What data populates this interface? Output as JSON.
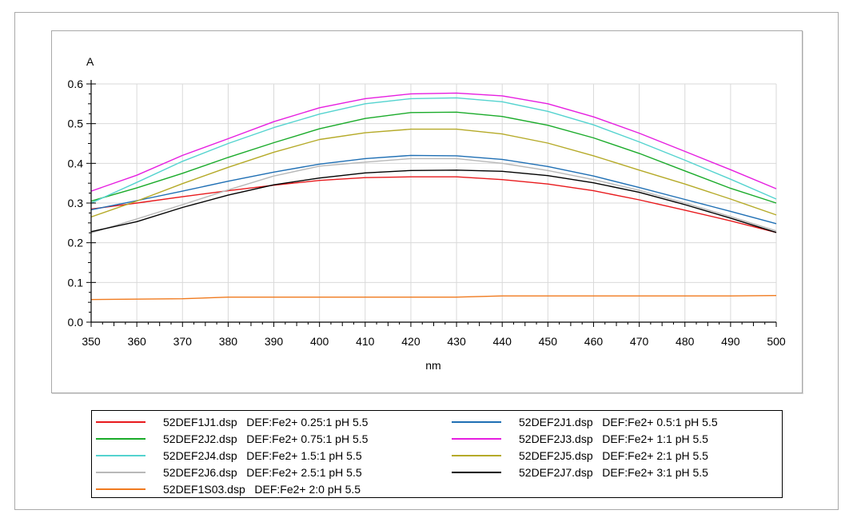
{
  "chart_data": {
    "type": "line",
    "ylabel": "A",
    "xlabel": "nm",
    "xlim": [
      350,
      500
    ],
    "ylim": [
      0,
      0.6
    ],
    "xticks": [
      "350",
      "360",
      "370",
      "380",
      "390",
      "400",
      "410",
      "420",
      "430",
      "440",
      "450",
      "460",
      "470",
      "480",
      "490",
      "500"
    ],
    "yticks": [
      "0.0",
      "0.1",
      "0.2",
      "0.3",
      "0.4",
      "0.5",
      "0.6"
    ],
    "grid": true,
    "legend_position": "bottom",
    "x": [
      350,
      360,
      370,
      380,
      390,
      400,
      410,
      420,
      430,
      440,
      450,
      460,
      470,
      480,
      490,
      500
    ],
    "series": [
      {
        "name": "52DEF1J1.dsp   DEF:Fe2+ 0.25:1 pH 5.5",
        "color": "#e8191c",
        "values": [
          0.285,
          0.3,
          0.316,
          0.331,
          0.345,
          0.357,
          0.364,
          0.366,
          0.366,
          0.359,
          0.348,
          0.331,
          0.308,
          0.282,
          0.255,
          0.226
        ]
      },
      {
        "name": "52DEF2J1.dsp   DEF:Fe2+ 0.5:1 pH 5.5",
        "color": "#1f6fb4",
        "values": [
          0.283,
          0.306,
          0.33,
          0.355,
          0.378,
          0.398,
          0.412,
          0.42,
          0.419,
          0.41,
          0.392,
          0.368,
          0.339,
          0.309,
          0.279,
          0.248
        ]
      },
      {
        "name": "52DEF2J2.dsp   DEF:Fe2+ 0.75:1 pH 5.5",
        "color": "#1aab2a",
        "values": [
          0.305,
          0.338,
          0.375,
          0.415,
          0.452,
          0.487,
          0.513,
          0.528,
          0.529,
          0.518,
          0.496,
          0.464,
          0.425,
          0.381,
          0.337,
          0.3
        ]
      },
      {
        "name": "52DEF2J3.dsp   DEF:Fe2+ 1:1 pH 5.5",
        "color": "#e61ee0",
        "values": [
          0.33,
          0.37,
          0.42,
          0.462,
          0.505,
          0.54,
          0.563,
          0.575,
          0.577,
          0.57,
          0.55,
          0.517,
          0.476,
          0.43,
          0.384,
          0.336
        ]
      },
      {
        "name": "52DEF2J4.dsp   DEF:Fe2+ 1.5:1 pH 5.5",
        "color": "#54d3cf",
        "values": [
          0.3,
          0.352,
          0.405,
          0.45,
          0.49,
          0.524,
          0.55,
          0.563,
          0.565,
          0.555,
          0.531,
          0.497,
          0.454,
          0.408,
          0.36,
          0.31
        ]
      },
      {
        "name": "52DEF2J5.dsp   DEF:Fe2+ 2:1 pH 5.5",
        "color": "#b5aa28",
        "values": [
          0.265,
          0.305,
          0.349,
          0.39,
          0.428,
          0.46,
          0.477,
          0.486,
          0.486,
          0.474,
          0.451,
          0.419,
          0.383,
          0.348,
          0.31,
          0.27
        ]
      },
      {
        "name": "52DEF2J6.dsp   DEF:Fe2+ 2.5:1 pH 5.5",
        "color": "#b8b8b8",
        "values": [
          0.225,
          0.26,
          0.296,
          0.333,
          0.368,
          0.393,
          0.403,
          0.412,
          0.412,
          0.4,
          0.382,
          0.359,
          0.332,
          0.3,
          0.266,
          0.23
        ]
      },
      {
        "name": "52DEF2J7.dsp   DEF:Fe2+ 3:1 pH 5.5",
        "color": "#000000",
        "values": [
          0.228,
          0.253,
          0.289,
          0.32,
          0.346,
          0.363,
          0.376,
          0.382,
          0.383,
          0.38,
          0.369,
          0.351,
          0.327,
          0.296,
          0.262,
          0.226
        ]
      },
      {
        "name": "52DEF1S03.dsp   DEF:Fe2+ 2:0 pH 5.5",
        "color": "#f07a1e",
        "values": [
          0.057,
          0.058,
          0.059,
          0.063,
          0.063,
          0.063,
          0.063,
          0.063,
          0.063,
          0.066,
          0.066,
          0.066,
          0.066,
          0.066,
          0.066,
          0.067
        ]
      }
    ]
  }
}
